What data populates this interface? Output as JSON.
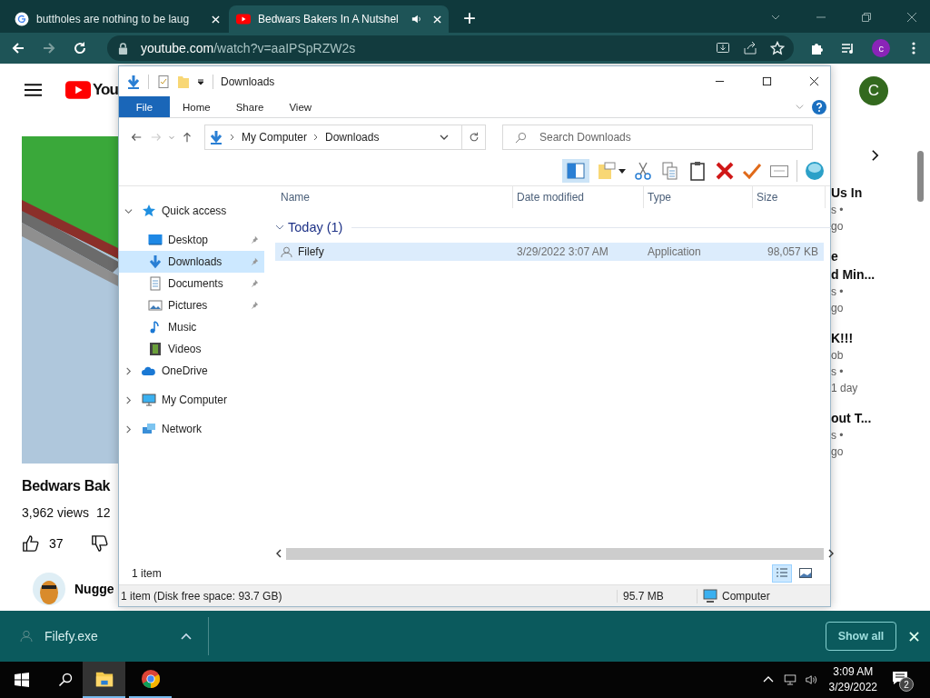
{
  "browser": {
    "tabs": [
      {
        "title": "buttholes are nothing to be laug",
        "kind": "google",
        "selected": false,
        "audio": false
      },
      {
        "title": "Bedwars Bakers In A Nutshel",
        "kind": "youtube",
        "selected": true,
        "audio": true
      }
    ],
    "new_tab": "+",
    "url_host": "youtube.com",
    "url_path": "/watch?v=aaIPSpRZW2s",
    "profile": "c"
  },
  "youtube": {
    "logo": "You",
    "avatar": "C",
    "video_title": "Bedwars Bak",
    "views": "3,962 views",
    "date": "12",
    "likes": "37",
    "channel": "Nugge",
    "suggestions": [
      {
        "title": [
          "Us In"
        ],
        "meta": [
          "s •",
          "go"
        ]
      },
      {
        "title": [
          "e",
          "d Min..."
        ],
        "meta": [
          "s •",
          "go"
        ]
      },
      {
        "title": [
          "K!!!"
        ],
        "meta": [
          "ob",
          "s •",
          "1 day"
        ]
      },
      {
        "title": [
          "out T..."
        ],
        "meta": [
          "s •",
          "go"
        ]
      }
    ]
  },
  "explorer": {
    "title": "Downloads",
    "ribbon_tabs": [
      {
        "label": "File",
        "selected": true
      },
      {
        "label": "Home",
        "selected": false
      },
      {
        "label": "Share",
        "selected": false
      },
      {
        "label": "View",
        "selected": false
      }
    ],
    "breadcrumb": [
      "My Computer",
      "Downloads"
    ],
    "search": {
      "placeholder": "Search Downloads"
    },
    "nav": [
      {
        "label": "Quick access",
        "kind": "star",
        "expanded": true,
        "selected": false,
        "children": [
          {
            "label": "Desktop",
            "kind": "desktop",
            "pinned": true,
            "selected": false
          },
          {
            "label": "Downloads",
            "kind": "download",
            "pinned": true,
            "selected": true
          },
          {
            "label": "Documents",
            "kind": "documents",
            "pinned": true,
            "selected": false
          },
          {
            "label": "Pictures",
            "kind": "pictures",
            "pinned": true,
            "selected": false
          },
          {
            "label": "Music",
            "kind": "music",
            "pinned": false,
            "selected": false
          },
          {
            "label": "Videos",
            "kind": "videos",
            "pinned": false,
            "selected": false
          }
        ]
      },
      {
        "label": "OneDrive",
        "kind": "cloud",
        "expanded": false,
        "selected": false
      },
      {
        "label": "My Computer",
        "kind": "computer",
        "expanded": false,
        "selected": false
      },
      {
        "label": "Network",
        "kind": "network",
        "expanded": false,
        "selected": false
      }
    ],
    "columns": [
      "Name",
      "Date modified",
      "Type",
      "Size"
    ],
    "groups": [
      {
        "label": "Today (1)",
        "expanded": true,
        "rows": [
          {
            "name": "Filefy",
            "date": "3/29/2022 3:07 AM",
            "type": "Application",
            "size": "98,057 KB",
            "selected": true
          }
        ]
      }
    ],
    "item_count": "1 item",
    "views": [
      {
        "kind": "details",
        "selected": true
      },
      {
        "kind": "preview",
        "selected": false
      }
    ],
    "status": {
      "info": "1 item (Disk free space: 93.7 GB)",
      "size": "95.7 MB",
      "location": "Computer"
    }
  },
  "download_bar": {
    "file": "Filefy.exe",
    "show_all": "Show all"
  },
  "taskbar": {
    "apps": [
      {
        "kind": "explorer",
        "active": true
      },
      {
        "kind": "chrome",
        "active": false
      }
    ],
    "time": "3:09 AM",
    "date": "3/29/2022",
    "notifications": "2"
  }
}
